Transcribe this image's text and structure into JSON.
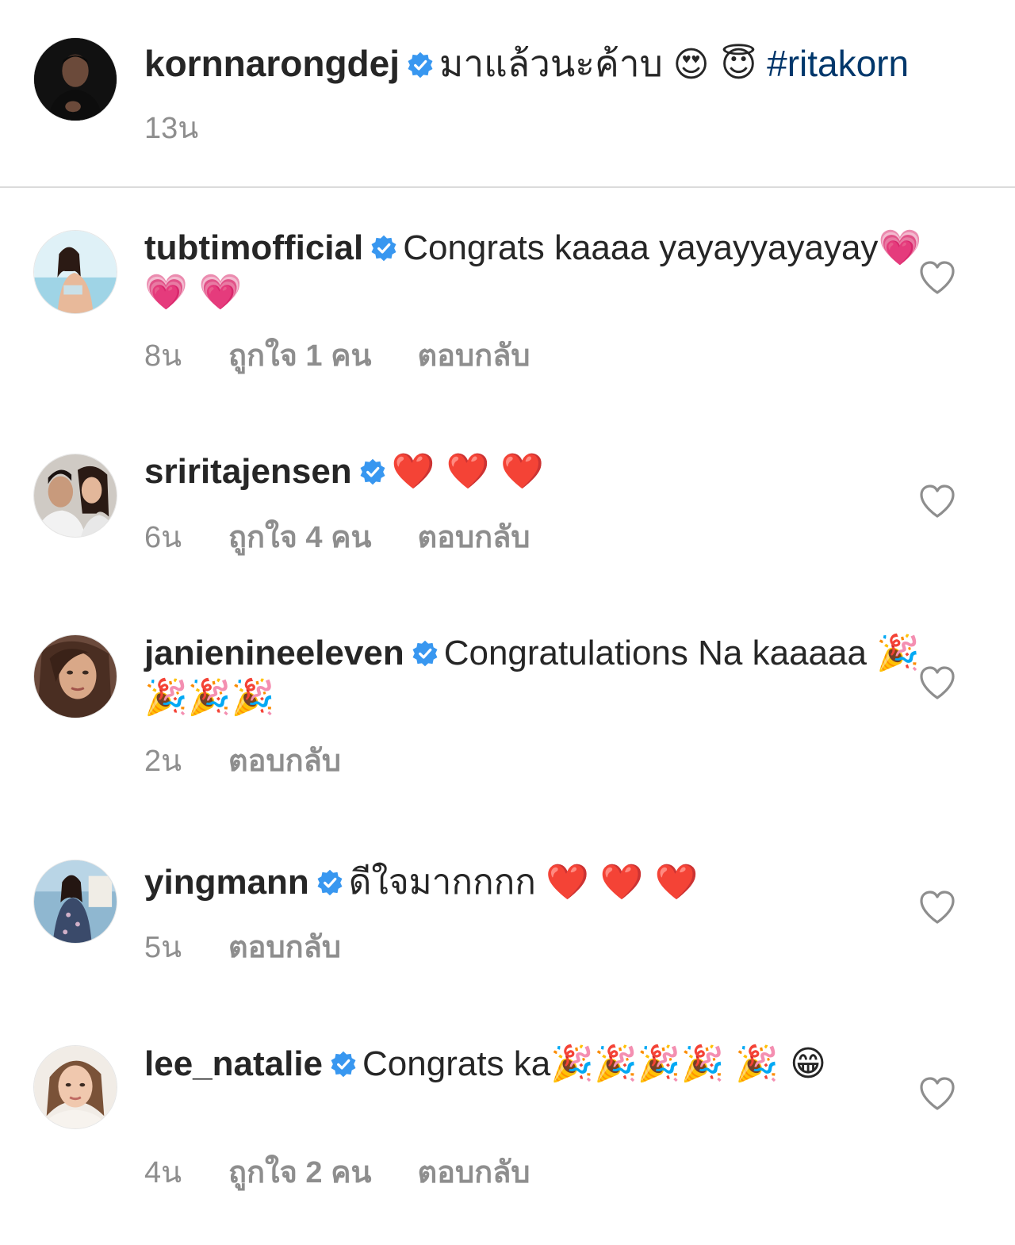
{
  "post": {
    "username": "kornnarongdej",
    "caption": "มาแล้วนะค้าบ",
    "caption_emoji": "😍 😇",
    "hashtag": "#ritakorn",
    "time": "13น"
  },
  "comments": [
    {
      "username": "tubtimofficial",
      "text": "Congrats kaaaa yayayyayayay",
      "emoji": "💗 💗 💗",
      "time": "8น",
      "likes": "ถูกใจ 1 คน",
      "reply": "ตอบกลับ"
    },
    {
      "username": "sriritajensen",
      "text": "",
      "emoji": "❤️ ❤️ ❤️",
      "time": "6น",
      "likes": "ถูกใจ 4 คน",
      "reply": "ตอบกลับ"
    },
    {
      "username": "janienineeleven",
      "text": "Congratulations Na kaaaaa",
      "emoji": "🎉🎉🎉🎉",
      "time": "2น",
      "likes": "",
      "reply": "ตอบกลับ"
    },
    {
      "username": "yingmann",
      "text": "ดีใจมากกกก",
      "emoji": "❤️ ❤️ ❤️",
      "time": "5น",
      "likes": "",
      "reply": "ตอบกลับ"
    },
    {
      "username": "lee_natalie",
      "text": "Congrats ka",
      "emoji": "🎉🎉🎉🎉 🎉 😁",
      "time": "4น",
      "likes": "ถูกใจ 2 คน",
      "reply": "ตอบกลับ"
    }
  ],
  "colors": {
    "verified_badge": "#3897f0",
    "hashtag": "#00376b",
    "secondary_text": "#8e8e8e",
    "primary_text": "#262626",
    "divider": "#dbdbdb"
  },
  "icons": {
    "verified": "verified-badge-icon",
    "like": "heart-outline-icon"
  }
}
